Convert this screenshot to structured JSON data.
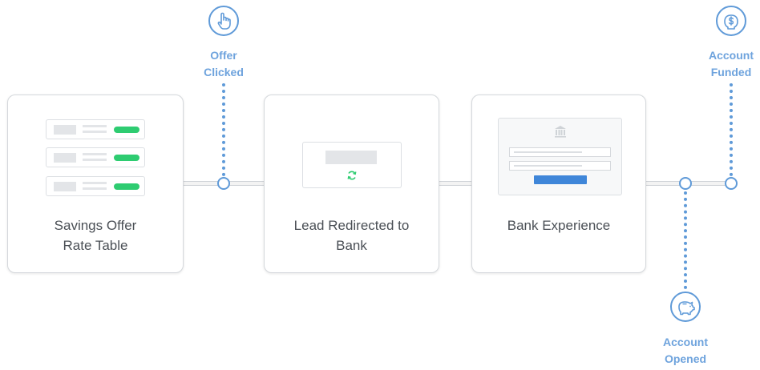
{
  "steps": [
    {
      "label": "Savings Offer Rate Table"
    },
    {
      "label": "Lead Redirected to Bank"
    },
    {
      "label": "Bank Experience"
    }
  ],
  "milestones": {
    "offer_clicked": {
      "line1": "Offer",
      "line2": "Clicked",
      "icon": "hand-pointer-icon"
    },
    "account_opened": {
      "line1": "Account",
      "line2": "Opened",
      "icon": "piggy-bank-icon"
    },
    "account_funded": {
      "line1": "Account",
      "line2": "Funded",
      "icon": "dollar-piggy-icon"
    }
  },
  "colors": {
    "accent": "#5f9ad8",
    "label": "#6ea3dd",
    "rate_pill": "#2ecc71",
    "bank_button": "#3f86d9",
    "card_border": "#d5d8dc"
  }
}
